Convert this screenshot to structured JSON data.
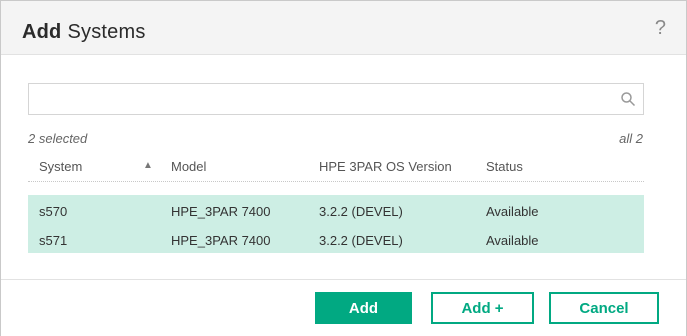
{
  "dialog": {
    "title_verb": "Add",
    "title_noun": "Systems",
    "help": "?"
  },
  "search": {
    "value": "",
    "placeholder": "",
    "icon": "search-icon"
  },
  "selection": {
    "selected_text": "2 selected",
    "all_text": "all 2"
  },
  "table": {
    "columns": [
      "System",
      "Model",
      "HPE 3PAR OS Version",
      "Status"
    ],
    "sort_indicator": "▲",
    "rows": [
      {
        "system": "s570",
        "model": "HPE_3PAR 7400",
        "version": "3.2.2 (DEVEL)",
        "status": "Available"
      },
      {
        "system": "s571",
        "model": "HPE_3PAR 7400",
        "version": "3.2.2 (DEVEL)",
        "status": "Available"
      }
    ]
  },
  "buttons": {
    "add": "Add",
    "add_plus": "Add +",
    "cancel": "Cancel"
  },
  "colors": {
    "accent": "#01a982",
    "selected_row": "#cdeee4"
  }
}
